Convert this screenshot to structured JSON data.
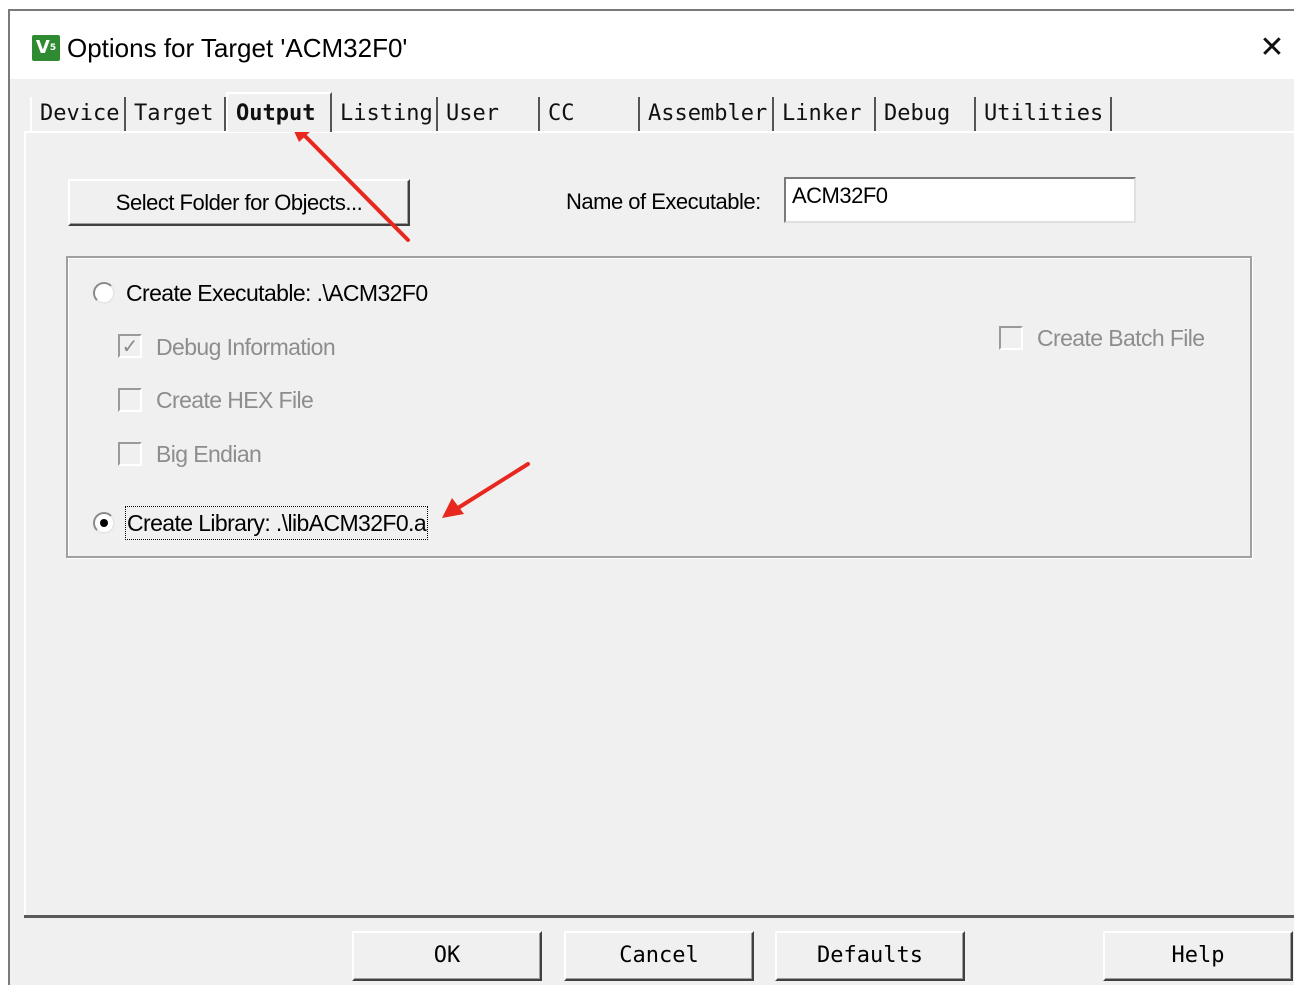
{
  "window": {
    "title": "Options for Target 'ACM32F0'",
    "icon_glyph": "V",
    "icon_sub": "5",
    "close_glyph": "✕"
  },
  "tabs": [
    {
      "label": "Device",
      "active": false
    },
    {
      "label": "Target",
      "active": false
    },
    {
      "label": "Output",
      "active": true
    },
    {
      "label": "Listing",
      "active": false
    },
    {
      "label": "User",
      "active": false
    },
    {
      "label": "CC",
      "active": false
    },
    {
      "label": "Assembler",
      "active": false
    },
    {
      "label": "Linker",
      "active": false
    },
    {
      "label": "Debug",
      "active": false
    },
    {
      "label": "Utilities",
      "active": false
    }
  ],
  "output": {
    "select_folder_label": "Select Folder for Objects...",
    "name_of_executable_label": "Name of Executable:",
    "name_of_executable_value": "ACM32F0",
    "create_executable_label": "Create Executable:  .\\ACM32F0",
    "create_executable_selected": false,
    "debug_information_label": "Debug Information",
    "debug_information_checked": true,
    "create_hex_label": "Create HEX File",
    "create_hex_checked": false,
    "big_endian_label": "Big Endian",
    "big_endian_checked": false,
    "create_batch_label": "Create Batch File",
    "create_batch_checked": false,
    "create_library_label": "Create Library:  .\\libACM32F0.a",
    "create_library_selected": true
  },
  "footer": {
    "ok": "OK",
    "cancel": "Cancel",
    "defaults": "Defaults",
    "help": "Help"
  },
  "colors": {
    "annotation_arrow": "#e8281e",
    "icon_green": "#2e8b32",
    "disabled_text": "#8d8d8d"
  }
}
